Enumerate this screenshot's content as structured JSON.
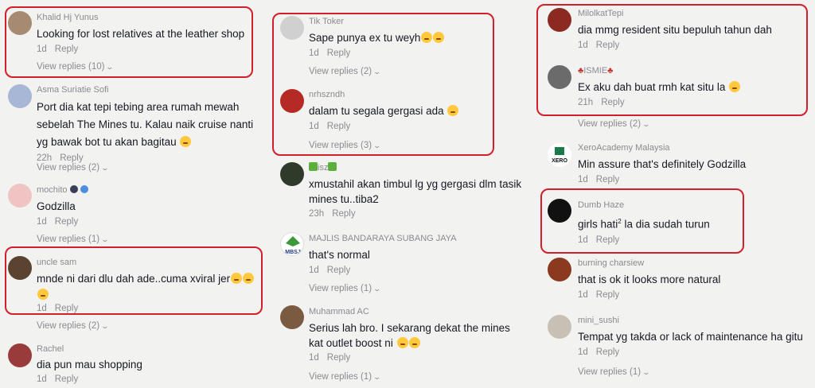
{
  "columns": [
    {
      "comments": [
        {
          "user": "Khalid Hj Yunus",
          "text": "Looking for lost relatives at the leather shop",
          "time": "1d",
          "reply": "Reply",
          "view_replies": "View replies (10)",
          "avatar_color": "#a68b72"
        },
        {
          "user": "Asma Suriatie Sofi",
          "text": "Port dia kat tepi tebing area rumah mewah sebelah The Mines tu. Kalau naik cruise nanti yg bawak bot tu akan bagitau",
          "time": "22h",
          "reply": "Reply",
          "view_replies": "View replies (2)",
          "avatar_color": "#a9b7d6"
        },
        {
          "user": "mochito",
          "text": "Godzilla",
          "time": "1d",
          "reply": "Reply",
          "view_replies": "View replies (1)",
          "avatar_color": "#f1c4c4"
        },
        {
          "user": "uncle sam",
          "text": "mnde ni dari dlu dah ade..cuma xviral jer",
          "time": "1d",
          "reply": "Reply",
          "view_replies": "View replies (2)",
          "avatar_color": "#5a4330"
        },
        {
          "user": "Rachel",
          "text": "dia pun mau shopping",
          "time": "1d",
          "reply": "Reply",
          "avatar_color": "#9a3b3b"
        }
      ]
    },
    {
      "comments": [
        {
          "user": "Tik Toker",
          "text": "Sape punya ex tu weyh",
          "time": "1d",
          "reply": "Reply",
          "view_replies": "View replies (2)",
          "avatar_color": "#d0d0d0"
        },
        {
          "user": "nrhszndh",
          "text": "dalam tu segala gergasi ada",
          "time": "1d",
          "reply": "Reply",
          "view_replies": "View replies (3)",
          "avatar_color": "#b52a25"
        },
        {
          "user": "isz",
          "text": "xmustahil akan timbul lg yg gergasi dlm tasik mines tu..tiba2",
          "time": "23h",
          "reply": "Reply",
          "avatar_color": "#2f3a2a"
        },
        {
          "user": "MAJLIS BANDARAYA SUBANG JAYA",
          "text": "that's normal",
          "time": "1d",
          "reply": "Reply",
          "view_replies": "View replies (1)",
          "avatar_color": "#ffffff",
          "avatar_label": "MBSJ"
        },
        {
          "user": "Muhammad AC",
          "text": "Serius lah bro. I sekarang dekat the mines kat outlet boost ni",
          "time": "1d",
          "reply": "Reply",
          "view_replies": "View replies (1)",
          "avatar_color": "#7a5a40"
        }
      ]
    },
    {
      "comments": [
        {
          "user": "MilolkatTepi",
          "text": "dia mmg resident situ bepuluh tahun dah",
          "time": "1d",
          "reply": "Reply",
          "avatar_color": "#8a2a20"
        },
        {
          "user": "ISMIE",
          "text": "Ex aku dah buat rmh kat situ la",
          "time": "21h",
          "reply": "Reply",
          "view_replies": "View replies (2)",
          "avatar_color": "#6b6b6b"
        },
        {
          "user": "XeroAcademy Malaysia",
          "text": "Min assure that's definitely Godzilla",
          "time": "1d",
          "reply": "Reply",
          "avatar_color": "#ffffff",
          "avatar_label": "XERO"
        },
        {
          "user": "Dumb Haze",
          "text_pre": "girls hati",
          "text_sup": "2",
          "text_post": " la dia sudah turun",
          "time": "1d",
          "reply": "Reply",
          "avatar_color": "#111111"
        },
        {
          "user": "burning charsiew",
          "text": "that is ok it looks more natural",
          "time": "1d",
          "reply": "Reply",
          "avatar_color": "#8b3a1f"
        },
        {
          "user": "mini_sushi",
          "text": "Tempat yg takda or lack of maintenance ha gitu",
          "time": "1d",
          "reply": "Reply",
          "view_replies": "View replies (1)",
          "avatar_color": "#c9c0b5"
        }
      ]
    }
  ],
  "colors": {
    "highlight": "#d21f2b",
    "muted": "#8a8b91",
    "text": "#161823",
    "background": "#f2f2f0"
  },
  "icons": {
    "view_replies": "chevron-down-icon",
    "emoji": "laughing-emoji-icon"
  }
}
